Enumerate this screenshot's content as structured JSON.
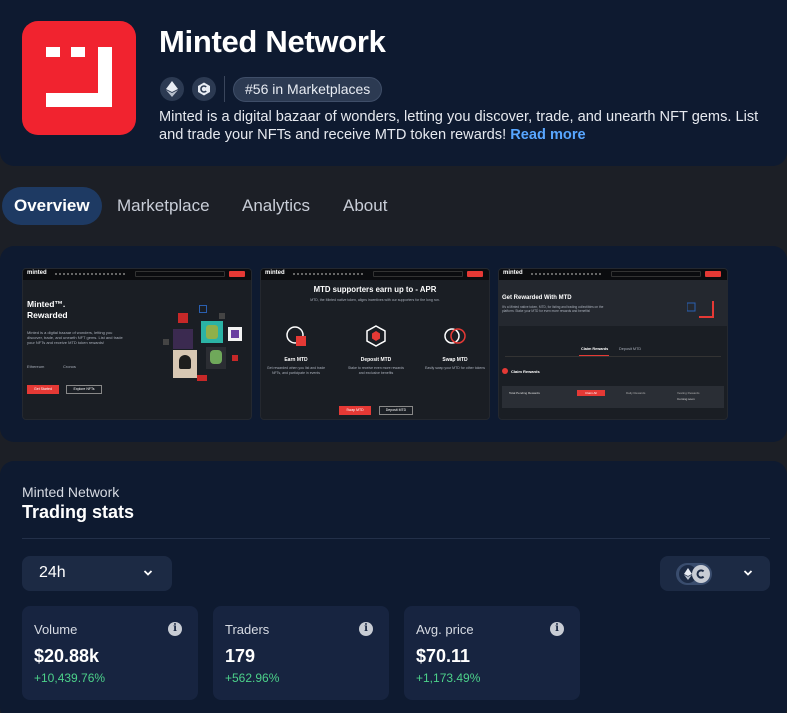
{
  "app": {
    "title": "Minted Network",
    "rank_badge": "#56 in Marketplaces",
    "description": "Minted is a digital bazaar of wonders, letting you discover, trade, and unearth NFT gems. List and trade your NFTs and receive MTD token rewards!",
    "read_more": "Read more",
    "logo_color": "#f1232f",
    "chain_icons": [
      "ethereum-icon",
      "cronos-icon"
    ]
  },
  "tabs": [
    {
      "label": "Overview",
      "active": true
    },
    {
      "label": "Marketplace",
      "active": false
    },
    {
      "label": "Analytics",
      "active": false
    },
    {
      "label": "About",
      "active": false
    }
  ],
  "screenshots": [
    {
      "brand": "minted",
      "heading": "Minted™. Rewarded",
      "body": "Minted is a digital bazaar of wonders, letting you discover, trade, and unearth NFT gems. List and trade your NFTs and receive MTD token rewards!",
      "chain_a": "Ethereum",
      "chain_b": "Cronos",
      "primary_btn": "Get Started",
      "secondary_btn": "Explore NFTs"
    },
    {
      "brand": "minted",
      "heading": "MTD supporters earn up to - APR",
      "subheading": "MTD, the Minted native token, aligns incentives with our supporters for the long run.",
      "features": [
        {
          "title": "Earn MTD",
          "text": "Get rewarded when you list and trade NFTs, and participate in events"
        },
        {
          "title": "Deposit MTD",
          "text": "Stake to receive even more rewards and exclusive benefits"
        },
        {
          "title": "Swap MTD",
          "text": "Easily swap your MTD for other tokens"
        }
      ],
      "primary_btn": "Swap MTD",
      "secondary_btn": "Deposit MTD"
    },
    {
      "brand": "minted",
      "heading": "Get Rewarded With MTD",
      "body": "It's a Minted native token, MTD, for listing and trading collectibles on the platform. Stake your MTD for even more rewards and benefits!",
      "tab_a": "Claim Rewards",
      "tab_b": "Deposit MTD",
      "section": "Claim Rewards",
      "row_label": "Total Pending Rewards",
      "row_btn": "Claim All",
      "col_a": "Daily Rewards",
      "col_b": "Vesting Rewards",
      "col_b_value": "Coming soon"
    }
  ],
  "stats": {
    "eyebrow": "Minted Network",
    "title": "Trading stats",
    "period": "24h",
    "tiles": [
      {
        "label": "Volume",
        "value": "$20.88k",
        "change": "+10,439.76%"
      },
      {
        "label": "Traders",
        "value": "179",
        "change": "+562.96%"
      },
      {
        "label": "Avg. price",
        "value": "$70.11",
        "change": "+1,173.49%"
      }
    ],
    "positive_color": "#4cd18a"
  }
}
